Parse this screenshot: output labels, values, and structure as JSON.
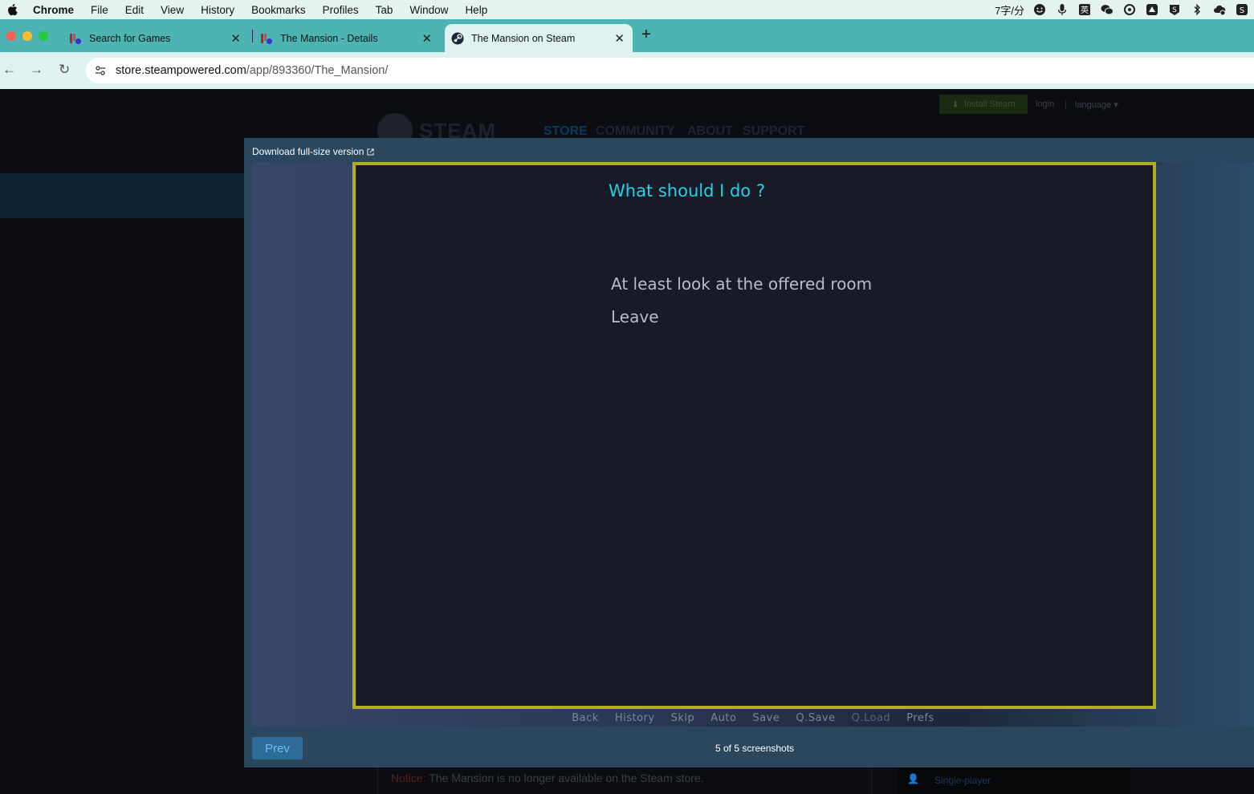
{
  "menubar": {
    "app": "Chrome",
    "items": [
      "File",
      "Edit",
      "View",
      "History",
      "Bookmarks",
      "Profiles",
      "Tab",
      "Window",
      "Help"
    ],
    "input_method": "7字/分"
  },
  "tabs": [
    {
      "title": "Search for Games"
    },
    {
      "title": "The Mansion - Details"
    },
    {
      "title": "The Mansion on Steam"
    }
  ],
  "address": {
    "domain": "store.steampowered.com",
    "path": "/app/893360/The_Mansion/"
  },
  "steam_page": {
    "install_label": "Install Steam",
    "login_label": "login",
    "separator": "|",
    "language_label": "language",
    "logo_text": "STEAM",
    "nav": [
      "STORE",
      "COMMUNITY",
      "ABOUT",
      "SUPPORT"
    ],
    "notice_label": "Notice:",
    "notice_text": "The Mansion is no longer available on the Steam store.",
    "feature_label": "Single-player"
  },
  "modal": {
    "download_label": "Download full-size version",
    "prev_label": "Prev",
    "count_text": "5 of 5 screenshots"
  },
  "game_screen": {
    "question": "What should I do ?",
    "choices": [
      "At least look at the offered room",
      "Leave"
    ],
    "menu": [
      "Back",
      "History",
      "Skip",
      "Auto",
      "Save",
      "Q.Save",
      "Q.Load",
      "Prefs"
    ],
    "menu_dimmed": "Q.Load"
  },
  "colors": {
    "tabstrip": "#4db3b3",
    "modal": "#2a475e",
    "question": "#22d3e6",
    "frame_border": "#b5ad1c",
    "prev_button": "#2e6b96"
  }
}
